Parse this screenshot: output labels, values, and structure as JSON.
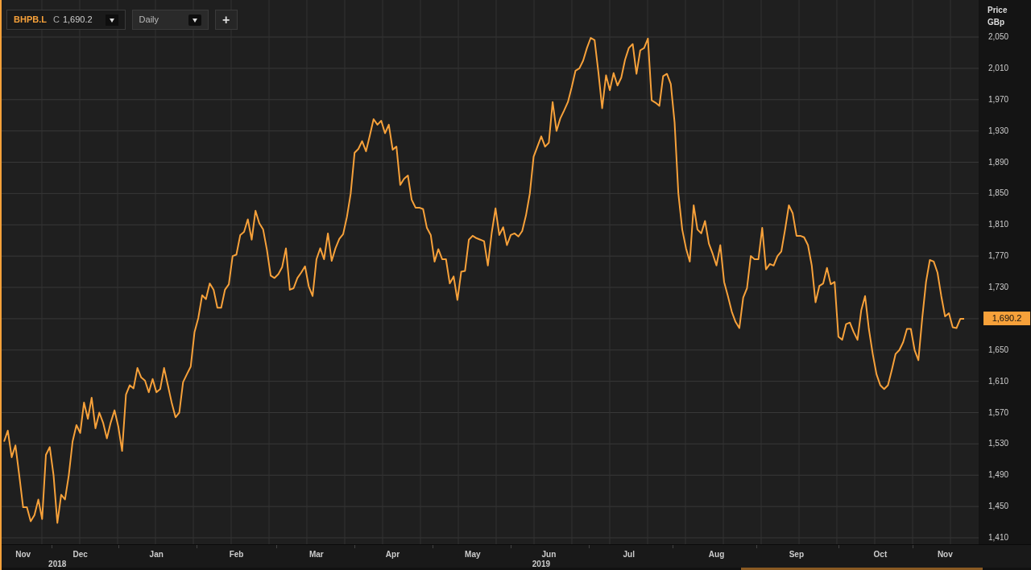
{
  "toolbar": {
    "price_type": "C",
    "price": "1,690.2",
    "interval": "Daily",
    "add_button": "+"
  },
  "last_price": "1,690.2",
  "chart_data": {
    "type": "line",
    "ylabel": "Price GBp",
    "grid": true,
    "ylim": [
      1410,
      2050
    ],
    "yticks": [
      {
        "value": 1410,
        "label": "1,410"
      },
      {
        "value": 1450,
        "label": "1,450"
      },
      {
        "value": 1490,
        "label": "1,490"
      },
      {
        "value": 1530,
        "label": "1,530"
      },
      {
        "value": 1570,
        "label": "1,570"
      },
      {
        "value": 1610,
        "label": "1,610"
      },
      {
        "value": 1650,
        "label": "1,650"
      },
      {
        "value": 1730,
        "label": "1,730"
      },
      {
        "value": 1770,
        "label": "1,770"
      },
      {
        "value": 1810,
        "label": "1,810"
      },
      {
        "value": 1850,
        "label": "1,850"
      },
      {
        "value": 1890,
        "label": "1,890"
      },
      {
        "value": 1930,
        "label": "1,930"
      },
      {
        "value": 1970,
        "label": "1,970"
      },
      {
        "value": 2010,
        "label": "2,010"
      },
      {
        "value": 2050,
        "label": "2,050"
      }
    ],
    "categories": [
      null,
      null,
      null,
      null,
      null,
      "Nov",
      null,
      null,
      null,
      null,
      null,
      null,
      null,
      null,
      null,
      null,
      null,
      null,
      null,
      null,
      "Dec",
      null,
      null,
      null,
      null,
      null,
      null,
      null,
      null,
      null,
      null,
      null,
      null,
      null,
      null,
      null,
      null,
      null,
      null,
      null,
      "Jan",
      null,
      null,
      null,
      null,
      null,
      null,
      null,
      null,
      null,
      null,
      null,
      null,
      null,
      null,
      null,
      null,
      null,
      null,
      null,
      null,
      "Feb",
      null,
      null,
      null,
      null,
      null,
      null,
      null,
      null,
      null,
      null,
      null,
      null,
      null,
      null,
      null,
      null,
      null,
      null,
      null,
      null,
      "Mar",
      null,
      null,
      null,
      null,
      null,
      null,
      null,
      null,
      null,
      null,
      null,
      null,
      null,
      null,
      null,
      null,
      null,
      null,
      null,
      "Apr",
      null,
      null,
      null,
      null,
      null,
      null,
      null,
      null,
      null,
      null,
      null,
      null,
      null,
      null,
      null,
      null,
      null,
      null,
      null,
      null,
      "May",
      null,
      null,
      null,
      null,
      null,
      null,
      null,
      null,
      null,
      null,
      null,
      null,
      null,
      null,
      null,
      null,
      null,
      null,
      null,
      "Jun",
      null,
      null,
      null,
      null,
      null,
      null,
      null,
      null,
      null,
      null,
      null,
      null,
      null,
      null,
      null,
      null,
      null,
      null,
      null,
      null,
      "Jul",
      null,
      null,
      null,
      null,
      null,
      null,
      null,
      null,
      null,
      null,
      null,
      null,
      null,
      null,
      null,
      null,
      null,
      null,
      null,
      null,
      null,
      null,
      "Aug",
      null,
      null,
      null,
      null,
      null,
      null,
      null,
      null,
      null,
      null,
      null,
      null,
      null,
      null,
      null,
      null,
      null,
      null,
      null,
      null,
      "Sep",
      null,
      null,
      null,
      null,
      null,
      null,
      null,
      null,
      null,
      null,
      null,
      null,
      null,
      null,
      null,
      null,
      null,
      null,
      null,
      null,
      null,
      "Oct",
      null,
      null,
      null,
      null,
      null,
      null,
      null,
      null,
      null,
      null,
      null,
      null,
      null,
      null,
      null,
      null,
      "Nov",
      null,
      null,
      null,
      null,
      null
    ],
    "series": [
      {
        "name": "BHPB.L",
        "color": "#f7a13a",
        "values": [
          1533,
          1547,
          1513,
          1528,
          1490,
          1449,
          1449,
          1431,
          1439,
          1459,
          1434,
          1516,
          1526,
          1490,
          1429,
          1465,
          1459,
          1490,
          1533,
          1554,
          1544,
          1583,
          1562,
          1589,
          1550,
          1570,
          1557,
          1537,
          1557,
          1573,
          1552,
          1521,
          1593,
          1605,
          1601,
          1627,
          1615,
          1611,
          1596,
          1613,
          1596,
          1600,
          1627,
          1605,
          1583,
          1564,
          1570,
          1609,
          1619,
          1629,
          1673,
          1691,
          1720,
          1715,
          1735,
          1727,
          1704,
          1704,
          1727,
          1734,
          1770,
          1772,
          1797,
          1801,
          1817,
          1791,
          1828,
          1812,
          1804,
          1778,
          1745,
          1742,
          1747,
          1756,
          1780,
          1727,
          1729,
          1742,
          1749,
          1757,
          1731,
          1719,
          1766,
          1780,
          1766,
          1799,
          1764,
          1780,
          1792,
          1798,
          1820,
          1850,
          1902,
          1907,
          1917,
          1904,
          1924,
          1945,
          1938,
          1943,
          1927,
          1938,
          1906,
          1910,
          1861,
          1869,
          1873,
          1842,
          1832,
          1832,
          1830,
          1806,
          1797,
          1763,
          1779,
          1766,
          1766,
          1735,
          1744,
          1714,
          1750,
          1751,
          1791,
          1796,
          1793,
          1791,
          1789,
          1758,
          1800,
          1831,
          1797,
          1807,
          1784,
          1797,
          1799,
          1795,
          1802,
          1822,
          1850,
          1897,
          1910,
          1923,
          1910,
          1915,
          1967,
          1930,
          1946,
          1956,
          1967,
          1986,
          2007,
          2010,
          2020,
          2036,
          2049,
          2046,
          2005,
          1959,
          2001,
          1982,
          2004,
          1988,
          1998,
          2021,
          2036,
          2041,
          2003,
          2033,
          2036,
          2048,
          1969,
          1966,
          1962,
          2000,
          2003,
          1990,
          1941,
          1850,
          1804,
          1780,
          1763,
          1835,
          1804,
          1799,
          1815,
          1786,
          1773,
          1758,
          1784,
          1737,
          1719,
          1699,
          1686,
          1678,
          1717,
          1729,
          1770,
          1766,
          1766,
          1806,
          1753,
          1760,
          1758,
          1770,
          1776,
          1804,
          1835,
          1825,
          1796,
          1796,
          1794,
          1784,
          1758,
          1711,
          1732,
          1735,
          1755,
          1734,
          1737,
          1667,
          1663,
          1683,
          1685,
          1673,
          1663,
          1701,
          1719,
          1677,
          1645,
          1619,
          1605,
          1600,
          1605,
          1624,
          1645,
          1650,
          1660,
          1677,
          1677,
          1650,
          1637,
          1691,
          1737,
          1765,
          1763,
          1749,
          1719,
          1693,
          1697,
          1679,
          1678,
          1690,
          1690
        ]
      }
    ]
  },
  "year_labels": [
    "2018",
    "2019"
  ]
}
